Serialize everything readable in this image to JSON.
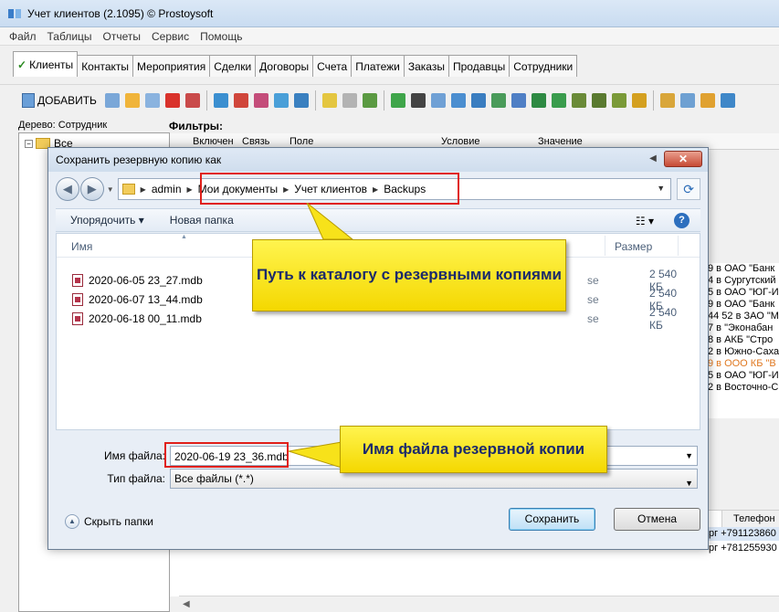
{
  "app": {
    "title": "Учет клиентов (2.1095) © Prostoysoft",
    "menu": [
      "Файл",
      "Таблицы",
      "Отчеты",
      "Сервис",
      "Помощь"
    ],
    "tabs": [
      "Клиенты",
      "Контакты",
      "Мероприятия",
      "Сделки",
      "Договоры",
      "Счета",
      "Платежи",
      "Заказы",
      "Продавцы",
      "Сотрудники"
    ],
    "add_button": "ДОБАВИТЬ",
    "tree_label": "Дерево: Сотрудник",
    "tree_root": "Все",
    "filters_label": "Фильтры:",
    "filter_columns": [
      "Включен",
      "Связь",
      "Поле",
      "Условие",
      "Значение"
    ],
    "right_rows": [
      "9 в ОАО \"Банк",
      "4 в Сургутский",
      "5 в ОАО \"ЮГ-И",
      "9 в ОАО \"Банк",
      "44 52 в ЗАО \"М",
      "7 в \"Эконабан",
      "8 в АКБ \"Стро",
      "2 в Южно-Саха",
      "9 в ООО КБ \"В",
      "5 в ОАО \"ЮГ-И",
      "2 в Восточно-С"
    ],
    "phone_header": "Телефон",
    "phone_rows": [
      {
        "city": "рг",
        "phone": "+791123860"
      },
      {
        "city": "рг",
        "phone": "+781255930"
      }
    ],
    "accent_orange": "#e07820"
  },
  "dialog": {
    "title": "Сохранить резервную копию как",
    "breadcrumb": [
      "admin",
      "Мои документы",
      "Учет клиентов",
      "Backups"
    ],
    "organize": "Упорядочить",
    "new_folder": "Новая папка",
    "col_name": "Имя",
    "col_size": "Размер",
    "files": [
      {
        "name": "2020-06-05 23_27.mdb",
        "type": "se",
        "size": "2 540 КБ"
      },
      {
        "name": "2020-06-07 13_44.mdb",
        "type": "se",
        "size": "2 540 КБ"
      },
      {
        "name": "2020-06-18 00_11.mdb",
        "type": "se",
        "size": "2 540 КБ"
      }
    ],
    "filename_label": "Имя файла:",
    "filename_value": "2020-06-19 23_36.mdb",
    "filetype_label": "Тип файла:",
    "filetype_value": "Все файлы (*.*)",
    "hide_folders": "Скрыть папки",
    "save": "Сохранить",
    "cancel": "Отмена"
  },
  "annotations": {
    "path_callout": "Путь к каталогу с резервными копиями",
    "filename_callout": "Имя файла резервной копии",
    "box_color": "#e0201a",
    "callout_color": "#f4d800"
  }
}
